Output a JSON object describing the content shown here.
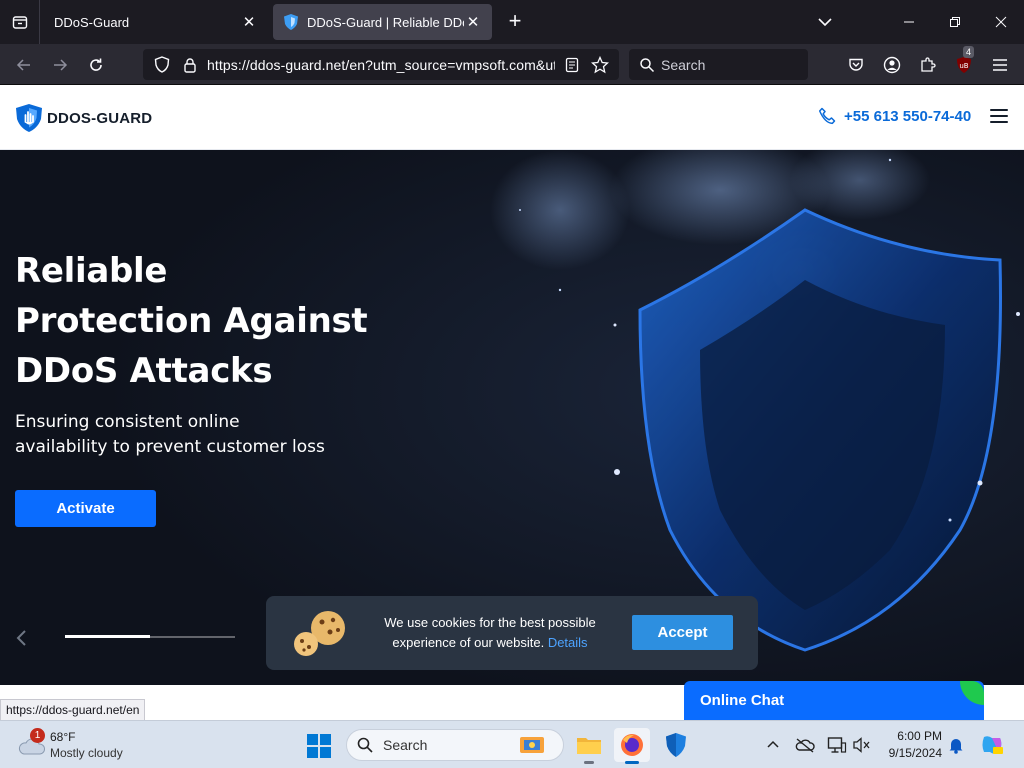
{
  "browser": {
    "tabs": [
      {
        "title": "DDoS-Guard",
        "active": false
      },
      {
        "title": "DDoS-Guard | Reliable DDoS Pr",
        "active": true
      }
    ],
    "url": "https://ddos-guard.net/en?utm_source=vmpsoft.com&ut",
    "search_placeholder": "Search",
    "extension_badge": "4",
    "status_url": "https://ddos-guard.net/en"
  },
  "site": {
    "logo_text": "DDOS-GUARD",
    "phone": "+55 613 550-74-40",
    "hero": {
      "title_lines": [
        "Reliable",
        "Protection Against",
        "DDoS Attacks"
      ],
      "subtitle_lines": [
        "Ensuring consistent online",
        "availability to prevent customer loss"
      ],
      "cta_label": "Activate",
      "slider_progress": 0.5
    },
    "cookie_banner": {
      "line1": "We use cookies for the best possible",
      "line2": "experience of our website.",
      "details_link": "Details",
      "accept_label": "Accept"
    },
    "chat_label": "Online Chat"
  },
  "taskbar": {
    "weather_temp": "68°F",
    "weather_condition": "Mostly cloudy",
    "weather_badge": "1",
    "search_placeholder": "Search",
    "time": "6:00 PM",
    "date": "9/15/2024"
  },
  "colors": {
    "accent_blue": "#0a6cff",
    "phone_blue": "#0a6ad8",
    "chat_green": "#1fc94e"
  }
}
